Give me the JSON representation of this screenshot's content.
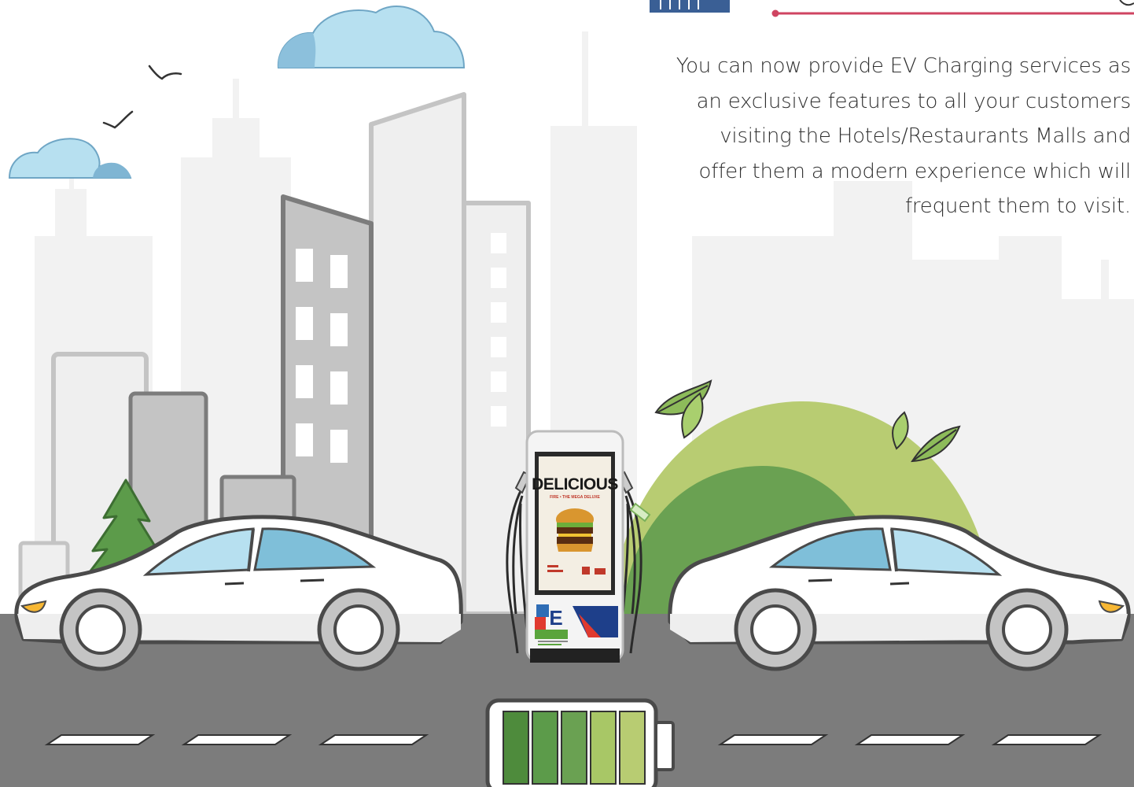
{
  "description": {
    "lines": [
      "You can now provide EV Charging services as",
      "an exclusive features to all your customers",
      "visiting the Hotels/Restaurants Malls  and",
      "offer them a modern experience which will",
      "frequent them to visit."
    ]
  },
  "charger": {
    "screen_title": "DELICIOUS",
    "screen_subtitle": "FIRE • THE MEGA DELUXE",
    "logo_letter": "E"
  },
  "battery": {
    "bars_filled": 5,
    "bars_total": 5
  },
  "colors": {
    "road": "#7c7c7c",
    "accent_line": "#cf4461",
    "hill_light": "#b8cc72",
    "hill_dark": "#6aa152",
    "sky_cloud": "#b7e0f0"
  },
  "icons": [
    "solar-panel-icon",
    "bird-icon",
    "cloud-icon",
    "leaf-icon",
    "tree-icon",
    "car-icon",
    "ev-charger-icon",
    "battery-icon"
  ]
}
